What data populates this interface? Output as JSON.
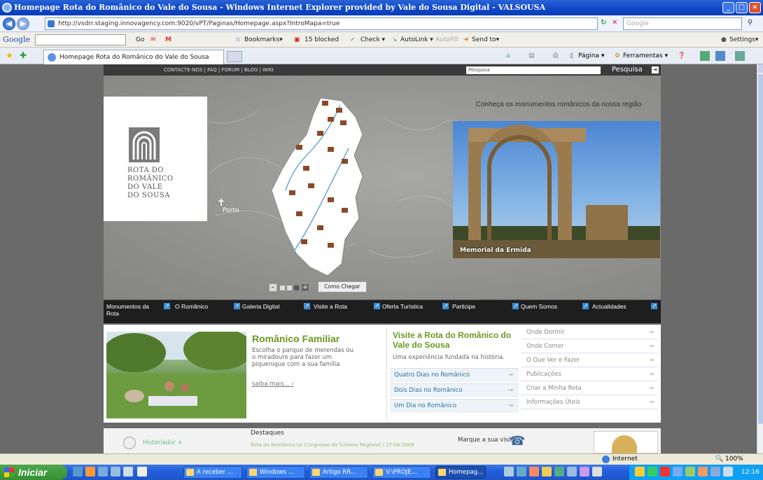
{
  "window": {
    "title": "Homepage Rota do Românico do Vale do Sousa - Windows Internet Explorer provided by Vale do Sousa Digital - VALSOUSA",
    "minimize": "_",
    "maximize": "□",
    "close": "×"
  },
  "address": {
    "url": "http://vsdrr.staging.innovagency.com:9020/vPT/Paginas/Homepage.aspx?IntroMapa=true",
    "search_placeholder": "Google"
  },
  "google_toolbar": {
    "brand": "Google",
    "go": "Go",
    "bookmarks": "Bookmarks▾",
    "blocked": "15 blocked",
    "check": "Check ▾",
    "autolink": "AutoLink ▾",
    "autofill": "AutoFill",
    "send_to": "Send to▾",
    "settings": "Settings▾"
  },
  "tabs": {
    "active_tab": "Homepage Rota do Românico do Vale do Sousa"
  },
  "commandbar": {
    "pagina": "Página ▾",
    "ferramentas": "Ferramentas ▾"
  },
  "site": {
    "top_links": "CONTACTE-NOS  |  FAQ  |  FORUM  |  BLOG  |  WIKI",
    "search_input_value": "Pesquisa",
    "search_label": "Pesquisa",
    "logo_text": "ROTA DO\nROMÂNICO\nDO VALE\nDO SOUSA",
    "porto_label": "Porto",
    "monument_heading": "Conheça os monumentos românicos da nossa região",
    "photo_caption": "Memorial da Ermida",
    "como_chegar": "Como Chegar",
    "nav": [
      {
        "label": "Monumentos da Rota"
      },
      {
        "label": "O Românico"
      },
      {
        "label": "Galeria Digital"
      },
      {
        "label": "Visite a Rota"
      },
      {
        "label": "Oferta Turística"
      },
      {
        "label": "Participe"
      },
      {
        "label": "Quem Somos"
      },
      {
        "label": "Actualidades"
      }
    ],
    "familiar": {
      "title": "Românico Familiar",
      "text": "Escolha o parque de merendas ou o miradouro para fazer um piquenique com a sua família",
      "more": "saiba mais..."
    },
    "visit": {
      "title": "Visite a Rota do Românico do Vale do Sousa",
      "subtitle": "Uma experiência fundada na história.",
      "links": [
        "Quatro Dias no Românico",
        "Dois Dias no Românico",
        "Um Dia no Românico"
      ]
    },
    "side_links": [
      "Onde Dormir",
      "Onde Comer",
      "O Que Ver e Fazer",
      "Publicações",
      "Criar a Minha Rota",
      "Informações Úteis"
    ],
    "bottom": {
      "historiador": "Historiador +",
      "destaques": "Destaques",
      "destaques_item": "Rota do Românico no Congresso de Turismo Regional / 17-04-2009",
      "marque": "Marque a sua visita"
    }
  },
  "status": {
    "zone": "Internet",
    "zoom": "100%"
  },
  "taskbar": {
    "start": "Iniciar",
    "tasks": [
      "A receber ...",
      "Windows ...",
      "Artigo RR...",
      "V:\\PROJE...",
      "Homepag..."
    ],
    "clock": "12:16"
  }
}
